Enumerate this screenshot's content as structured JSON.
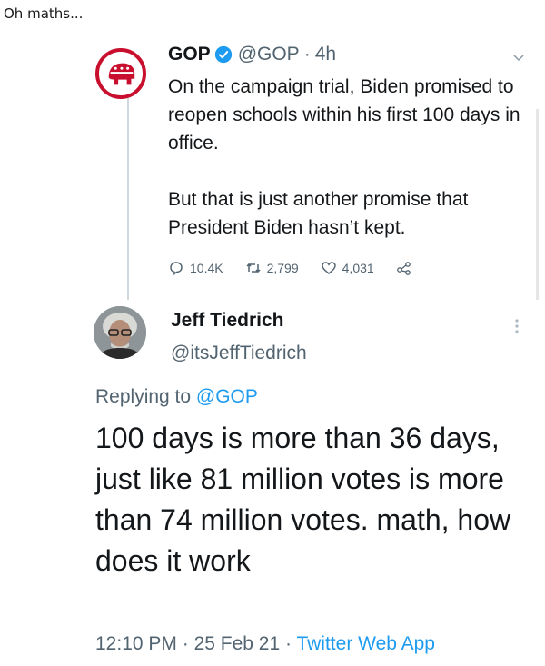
{
  "caption": "Oh maths...",
  "tweet1": {
    "name": "GOP",
    "handle": "@GOP",
    "separator": "·",
    "time": "4h",
    "text": "On the campaign trial, Biden promised to reopen schools within his first 100 days in office.\n\nBut that is just another promise that President Biden hasn’t kept.",
    "replies": "10.4K",
    "retweets": "2,799",
    "likes": "4,031",
    "icons": [
      "gop-elephant-icon",
      "verified-icon",
      "chevron-down-icon",
      "reply-icon",
      "retweet-icon",
      "like-icon",
      "share-icon"
    ],
    "colors": {
      "gop_red": "#c8102e",
      "verified_blue": "#1d9bf0"
    }
  },
  "tweet2": {
    "name": "Jeff Tiedrich",
    "handle": "@itsJeffTiedrich",
    "replying_prefix": "Replying to",
    "replying_to": "@GOP",
    "text": "100 days is more than 36 days, just like 81 million votes is more than 74 million votes. math, how does it work",
    "time": "12:10 PM",
    "date": "25 Feb 21",
    "separator": "·",
    "app": "Twitter Web App",
    "colors": {
      "link_blue": "#1d9bf0"
    }
  }
}
